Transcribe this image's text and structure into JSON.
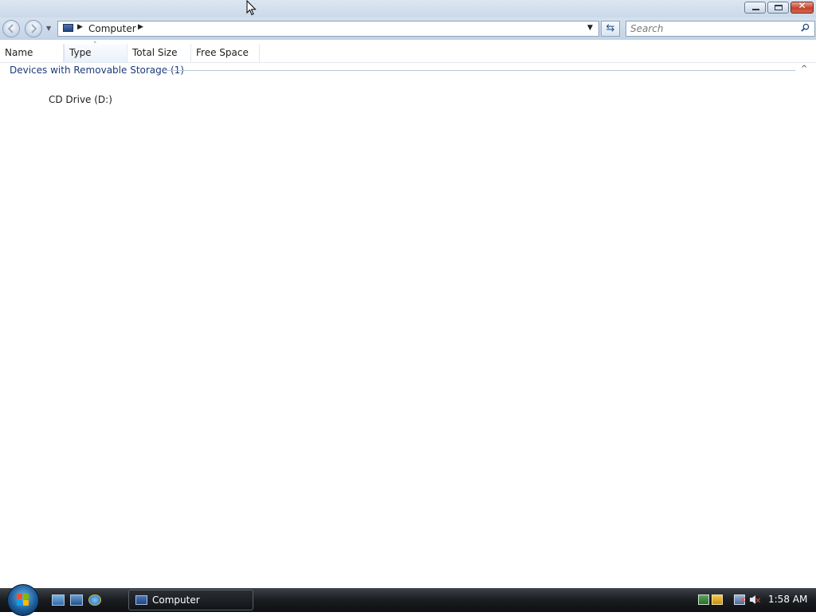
{
  "window": {
    "minimize_label": "",
    "maximize_label": "",
    "close_label": "✕"
  },
  "navbar": {
    "address_path": "Computer",
    "search_placeholder": "Search"
  },
  "columns": [
    {
      "label": "Name"
    },
    {
      "label": "Type",
      "sorted": true
    },
    {
      "label": "Total Size"
    },
    {
      "label": "Free Space"
    }
  ],
  "groups": [
    {
      "header": "Devices with Removable Storage (1)",
      "items": [
        {
          "label": "CD Drive (D:)"
        }
      ]
    }
  ],
  "taskbar": {
    "task_button_label": "Computer",
    "clock": "1:58 AM"
  },
  "icons": {
    "back": "back-arrow-icon",
    "forward": "forward-arrow-icon",
    "computer": "computer-icon",
    "refresh": "refresh-icon",
    "search": "search-icon",
    "start": "windows-start-icon"
  },
  "colors": {
    "group_header": "#1e3a7a",
    "taskbar": "#1c1f23",
    "close_button": "#c2422c"
  }
}
